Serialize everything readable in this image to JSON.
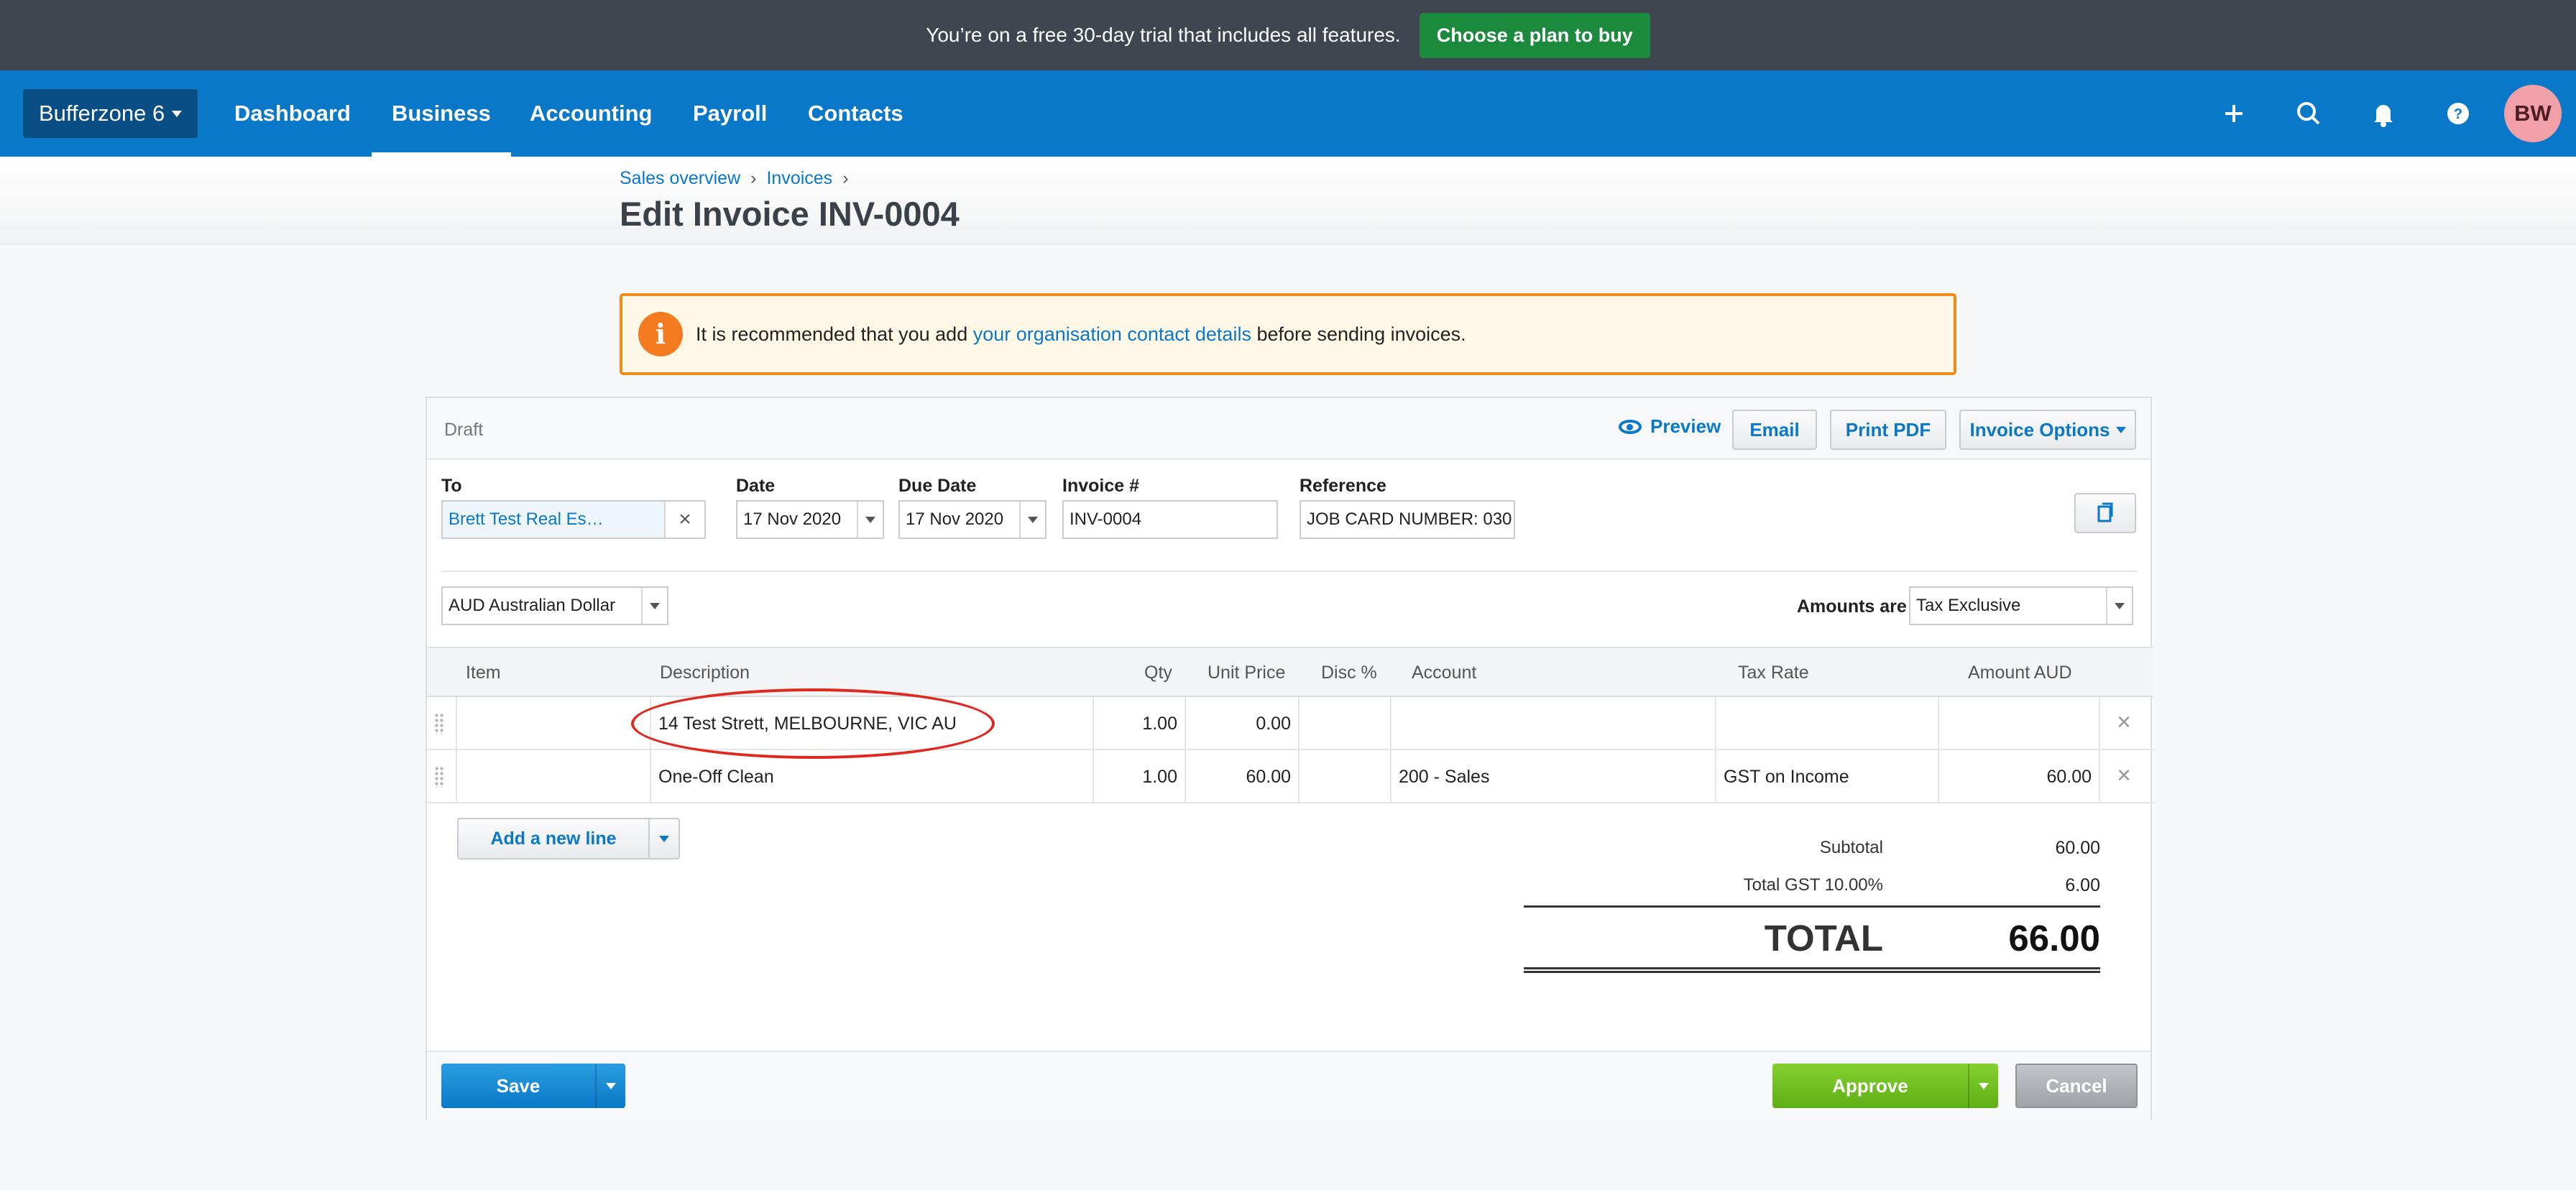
{
  "banner": {
    "text": "You’re on a free 30-day trial that includes all features.",
    "button": "Choose a plan to buy"
  },
  "nav": {
    "org": "Bufferzone 6",
    "items": [
      "Dashboard",
      "Business",
      "Accounting",
      "Payroll",
      "Contacts"
    ],
    "active": "Business",
    "avatar": "BW",
    "icons": [
      "plus-icon",
      "search-icon",
      "bell-icon",
      "help-icon"
    ]
  },
  "header": {
    "breadcrumbs": [
      "Sales overview",
      "Invoices"
    ],
    "title": "Edit Invoice INV-0004"
  },
  "warning": {
    "text_before": "It is recommended that you add ",
    "link": "your organisation contact details",
    "text_after": " before sending invoices."
  },
  "invoice": {
    "status": "Draft",
    "actions": {
      "preview": "Preview",
      "email": "Email",
      "print": "Print PDF",
      "options": "Invoice Options"
    },
    "fields": {
      "to_label": "To",
      "to_value": "Brett Test Real Es…",
      "date_label": "Date",
      "date_value": "17 Nov 2020",
      "due_label": "Due Date",
      "due_value": "17 Nov 2020",
      "number_label": "Invoice #",
      "number_value": "INV-0004",
      "reference_label": "Reference",
      "reference_value": "JOB CARD NUMBER: 030"
    },
    "currency": "AUD Australian Dollar",
    "amounts_label": "Amounts are",
    "amounts_value": "Tax Exclusive",
    "columns": [
      "Item",
      "Description",
      "Qty",
      "Unit Price",
      "Disc %",
      "Account",
      "Tax Rate",
      "Amount AUD"
    ],
    "rows": [
      {
        "item": "",
        "description": "14 Test Strett, MELBOURNE, VIC AU",
        "qty": "1.00",
        "unit_price": "0.00",
        "disc": "",
        "account": "",
        "tax_rate": "",
        "amount": ""
      },
      {
        "item": "",
        "description": "One-Off Clean",
        "qty": "1.00",
        "unit_price": "60.00",
        "disc": "",
        "account": "200 - Sales",
        "tax_rate": "GST on Income",
        "amount": "60.00"
      }
    ],
    "add_line": "Add a new line",
    "totals": {
      "subtotal_label": "Subtotal",
      "subtotal": "60.00",
      "gst_label": "Total GST 10.00%",
      "gst": "6.00",
      "total_label": "TOTAL",
      "total": "66.00"
    },
    "footer": {
      "save": "Save",
      "approve": "Approve",
      "cancel": "Cancel"
    }
  },
  "colors": {
    "nav": "#0a78c8",
    "banner": "#3f4650",
    "cta": "#1b8a3d",
    "warning_border": "#f08c1a",
    "approve": "#5fae14",
    "highlight": "#e0281e"
  }
}
